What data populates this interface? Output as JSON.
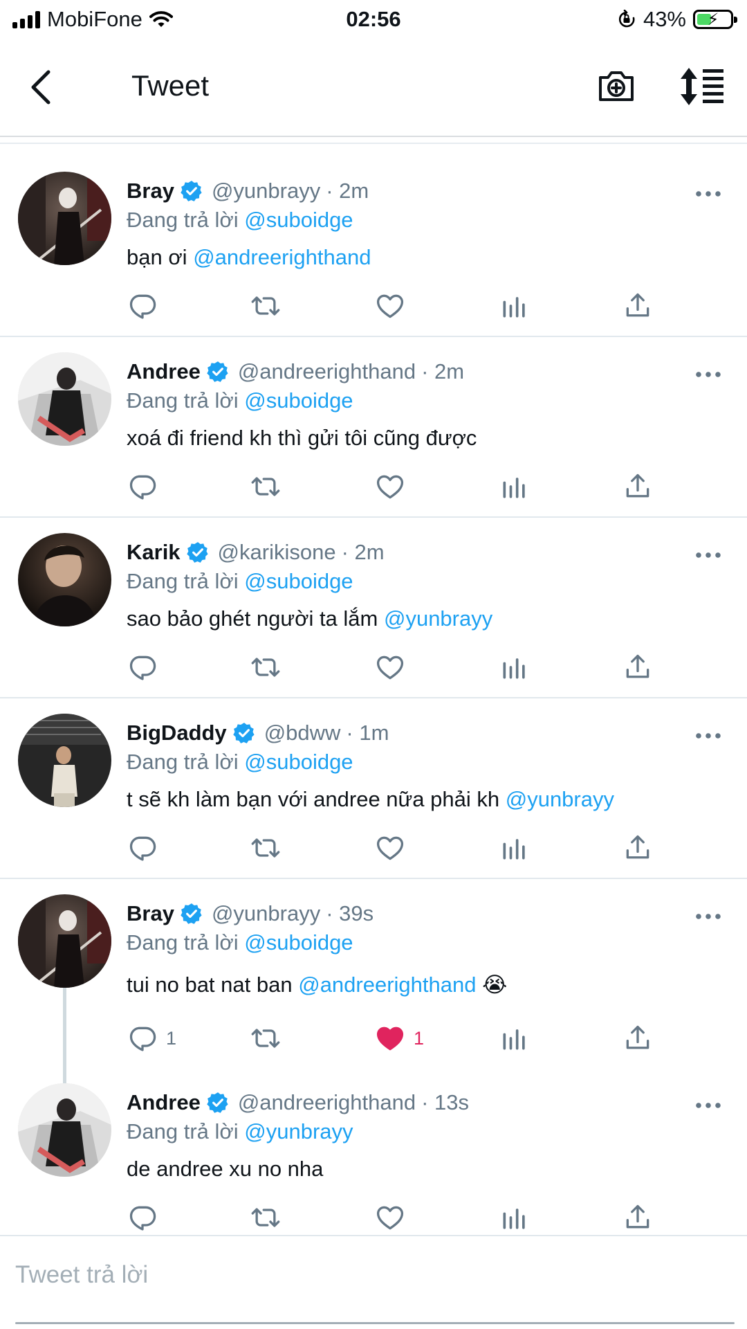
{
  "status_bar": {
    "carrier": "MobiFone",
    "time": "02:56",
    "battery": "43%",
    "battery_level": 0.43,
    "battery_fill_color": "#4cd964"
  },
  "header": {
    "title": "Tweet",
    "icons": [
      "back-arrow-icon",
      "camera-plus-icon",
      "sort-replies-icon"
    ]
  },
  "colors": {
    "accent": "#1da1f2",
    "like": "#e0245e",
    "muted": "#657786"
  },
  "tweets": [
    {
      "name": "Bray",
      "handle": "@yunbrayy",
      "time": "· 2m",
      "replying_label": "Đang trả lời",
      "replying_to": "@suboidge",
      "text": "bạn ơi",
      "mention": "@andreerighthand",
      "emoji": "",
      "reply_count": "",
      "like_count": "",
      "liked": false
    },
    {
      "name": "Andree",
      "handle": "@andreerighthand",
      "time": "· 2m",
      "replying_label": "Đang trả lời",
      "replying_to": "@suboidge",
      "text": "xoá đi friend kh thì gửi tôi cũng được",
      "mention": "",
      "emoji": "",
      "reply_count": "",
      "like_count": "",
      "liked": false
    },
    {
      "name": "Karik",
      "handle": "@karikisone",
      "time": "· 2m",
      "replying_label": "Đang trả lời",
      "replying_to": "@suboidge",
      "text": "sao bảo ghét người ta lắm",
      "mention": "@yunbrayy",
      "emoji": "",
      "reply_count": "",
      "like_count": "",
      "liked": false
    },
    {
      "name": "BigDaddy",
      "handle": "@bdww",
      "time": "· 1m",
      "replying_label": "Đang trả lời",
      "replying_to": "@suboidge",
      "text": "t sẽ kh làm bạn với andree nữa phải kh",
      "mention": "@yunbrayy",
      "emoji": "",
      "reply_count": "",
      "like_count": "",
      "liked": false
    },
    {
      "name": "Bray",
      "handle": "@yunbrayy",
      "time": "· 39s",
      "replying_label": "Đang trả lời",
      "replying_to": "@suboidge",
      "text": "tui no bat nat ban",
      "mention": "@andreerighthand",
      "emoji": "😭",
      "reply_count": "1",
      "like_count": "1",
      "liked": true
    },
    {
      "name": "Andree",
      "handle": "@andreerighthand",
      "time": "· 13s",
      "replying_label": "Đang trả lời",
      "replying_to": "@yunbrayy",
      "text": "de andree xu no nha",
      "mention": "",
      "emoji": "",
      "reply_count": "",
      "like_count": "",
      "liked": false
    }
  ],
  "reply_box": {
    "placeholder": "Tweet trả lời",
    "value": ""
  }
}
